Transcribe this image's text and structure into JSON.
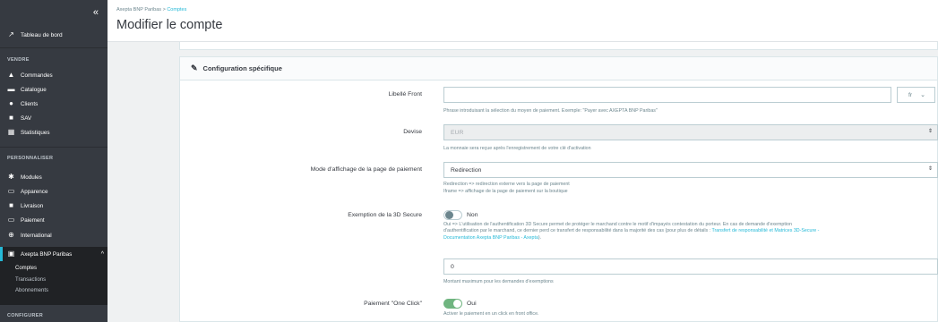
{
  "sidebar": {
    "collapse_glyph": "«",
    "dashboard": {
      "label": "Tableau de bord",
      "icon": "trending-up-icon"
    },
    "sections": [
      {
        "title": "VENDRE",
        "items": [
          {
            "label": "Commandes",
            "icon": "shopping-basket-icon"
          },
          {
            "label": "Catalogue",
            "icon": "store-icon"
          },
          {
            "label": "Clients",
            "icon": "account-circle-icon"
          },
          {
            "label": "SAV",
            "icon": "chat-icon"
          },
          {
            "label": "Statistiques",
            "icon": "chart-icon"
          }
        ]
      },
      {
        "title": "PERSONNALISER",
        "items": [
          {
            "label": "Modules",
            "icon": "puzzle-icon"
          },
          {
            "label": "Apparence",
            "icon": "desktop-icon"
          },
          {
            "label": "Livraison",
            "icon": "truck-icon"
          },
          {
            "label": "Paiement",
            "icon": "credit-card-icon"
          },
          {
            "label": "International",
            "icon": "globe-icon"
          },
          {
            "label": "Axepta BNP Paribas",
            "icon": "module-icon",
            "chevron": "^"
          }
        ]
      }
    ],
    "sub_items": [
      "Comptes",
      "Transactions",
      "Abonnements"
    ],
    "configure_title": "CONFIGURER"
  },
  "breadcrumb": {
    "root": "Axepta BNP Paribas",
    "separator": ">",
    "current": "Comptes"
  },
  "page_title": "Modifier le compte",
  "card": {
    "title": "Configuration spécifique",
    "fields": {
      "libelle": {
        "label": "Libellé Front",
        "value": "",
        "lang": "fr",
        "help": "Phrase introduisant la sélection du moyen de paiement. Exemple: \"Payer avec AXEPTA BNP Paribas\""
      },
      "devise": {
        "label": "Devise",
        "value": "EUR",
        "help": "La monnaie sera reçue après l'enregistrement de votre clé d'activation"
      },
      "mode": {
        "label": "Mode d'affichage de la page de paiement",
        "value": "Redirection",
        "help1": "Redirection => redirection externe vers la page de paiement",
        "help2": "Iframe => affichage de la page de paiement sur la boutique"
      },
      "exemption": {
        "label": "Exemption de la 3D Secure",
        "state": "Non",
        "help1": "Oui => L'utilisation de l'authentification 3D Secure permet de protéger le marchand contre le motif d'impayés contestation du porteur. En cas de demande d'exemption",
        "help2": "d'authentification par le marchand, ce dernier perd ce transfert de responsabilité dans la majorité des cas (pour plus de détails : ",
        "help_link2": "Transfert de responsabilité et Matrices 3D-Secure -",
        "help_link3": "Documentation Axepta BNP Paribas - Axepta",
        "help_end": ")."
      },
      "montant": {
        "value": "0",
        "help": "Montant maximum pour les demandes d'exemptions"
      },
      "oneclick": {
        "label": "Paiement \"One Click\"",
        "state": "Oui",
        "help": "Activer le paiement en un click en front office."
      }
    }
  }
}
